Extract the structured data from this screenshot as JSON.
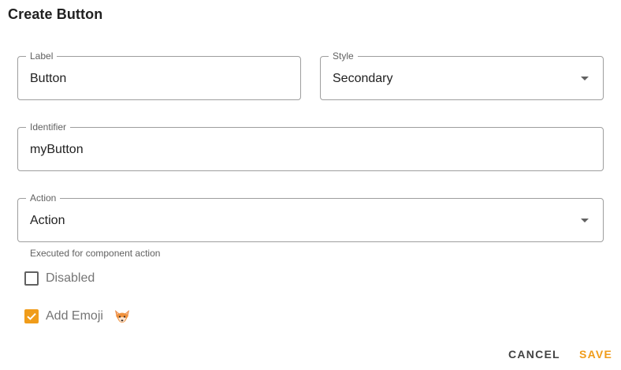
{
  "dialog": {
    "title": "Create Button"
  },
  "fields": {
    "label": {
      "legend": "Label",
      "value": "Button"
    },
    "style": {
      "legend": "Style",
      "value": "Secondary"
    },
    "identifier": {
      "legend": "Identifier",
      "value": "myButton"
    },
    "action": {
      "legend": "Action",
      "value": "Action",
      "helper": "Executed for component action"
    }
  },
  "checkboxes": {
    "disabled": {
      "label": "Disabled",
      "checked": false
    },
    "add_emoji": {
      "label": "Add Emoji",
      "checked": true,
      "emoji_icon": "fox-face-icon"
    }
  },
  "actions": {
    "cancel_label": "CANCEL",
    "save_label": "SAVE"
  },
  "colors": {
    "accent": "#f09c1a",
    "border": "#9e9e9e",
    "text": "#212121",
    "muted": "#757575"
  }
}
